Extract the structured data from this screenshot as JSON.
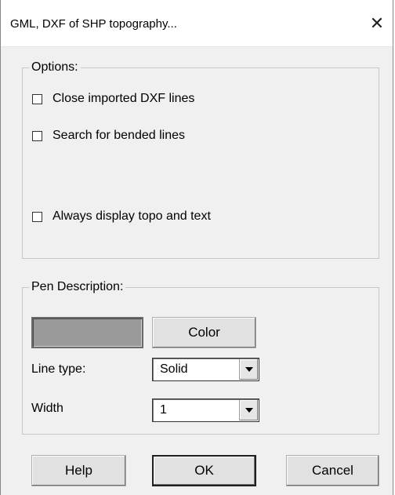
{
  "window": {
    "title": "GML, DXF of SHP topography...",
    "close_symbol": "✕"
  },
  "options_group": {
    "label": "Options:",
    "checkboxes": [
      {
        "label": "Close imported DXF lines",
        "checked": false
      },
      {
        "label": "Search for bended lines",
        "checked": false
      },
      {
        "label": "Always display topo and text",
        "checked": false
      }
    ]
  },
  "pen_group": {
    "label": "Pen Description:",
    "color_swatch": "#9a9a9a",
    "color_button": "Color",
    "line_type_label": "Line type:",
    "line_type_value": "Solid",
    "width_label": "Width",
    "width_value": "1"
  },
  "footer": {
    "help": "Help",
    "ok": "OK",
    "cancel": "Cancel"
  }
}
